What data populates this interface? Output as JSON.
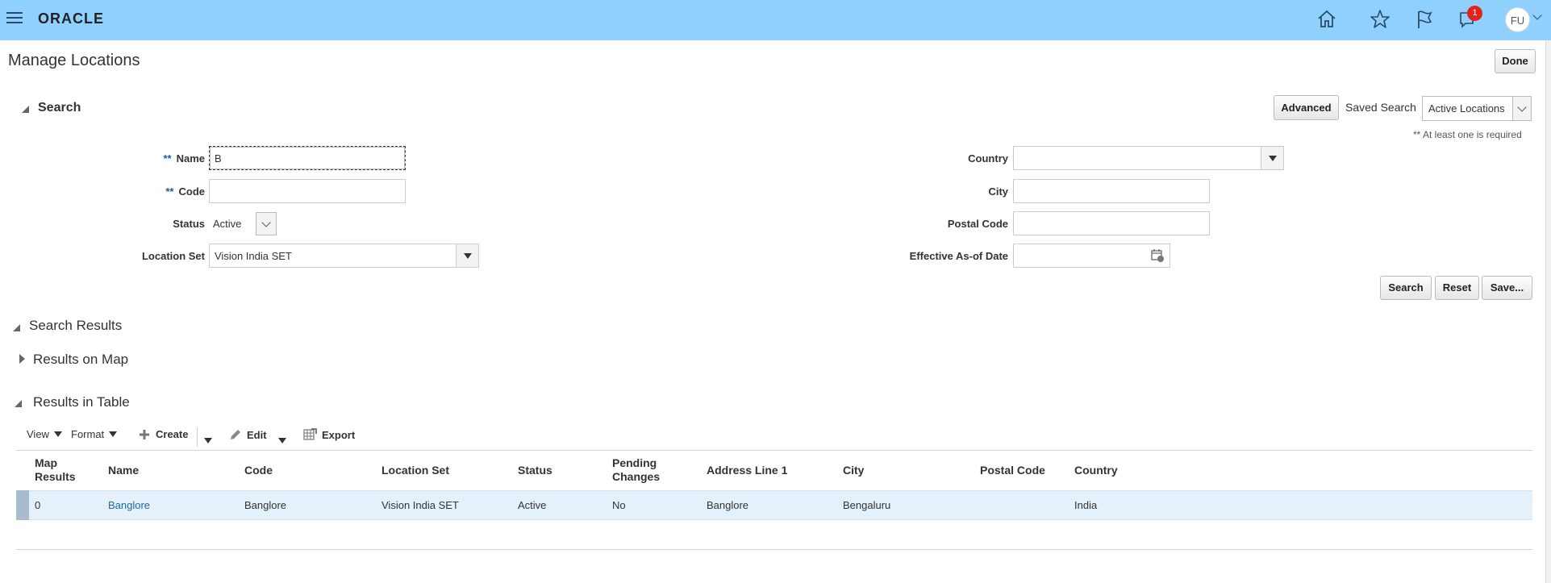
{
  "header": {
    "brand": "ORACLE",
    "notification_count": "1",
    "user_initials": "FU",
    "accent_color": "#8fd0ff"
  },
  "page": {
    "title": "Manage Locations",
    "done_label": "Done"
  },
  "search": {
    "section_title": "Search",
    "advanced_label": "Advanced",
    "saved_search_label": "Saved Search",
    "saved_search_value": "Active Locations",
    "required_note": "** At least one is required",
    "required_marker": "**",
    "fields": {
      "name_label": "Name",
      "name_value": "B",
      "code_label": "Code",
      "code_value": "",
      "status_label": "Status",
      "status_value": "Active",
      "location_set_label": "Location Set",
      "location_set_value": "Vision India SET",
      "country_label": "Country",
      "country_value": "",
      "city_label": "City",
      "city_value": "",
      "postal_code_label": "Postal Code",
      "postal_code_value": "",
      "effective_date_label": "Effective As-of Date",
      "effective_date_value": ""
    },
    "buttons": {
      "search": "Search",
      "reset": "Reset",
      "save": "Save..."
    }
  },
  "results": {
    "section_title": "Search Results",
    "map_title": "Results on Map",
    "table_title": "Results in Table",
    "toolbar": {
      "view": "View",
      "format": "Format",
      "create": "Create",
      "edit": "Edit",
      "export": "Export"
    },
    "columns": {
      "map_results_line1": "Map",
      "map_results_line2": "Results",
      "name": "Name",
      "code": "Code",
      "location_set": "Location Set",
      "status": "Status",
      "pending_line1": "Pending",
      "pending_line2": "Changes",
      "address_line_1": "Address Line 1",
      "city": "City",
      "postal_code": "Postal Code",
      "country": "Country"
    },
    "rows": [
      {
        "map_results": "0",
        "name": "Banglore",
        "code": "Banglore",
        "location_set": "Vision India SET",
        "status": "Active",
        "pending_changes": "No",
        "address_line_1": "Banglore",
        "city": "Bengaluru",
        "postal_code": "",
        "country": "India"
      }
    ]
  }
}
